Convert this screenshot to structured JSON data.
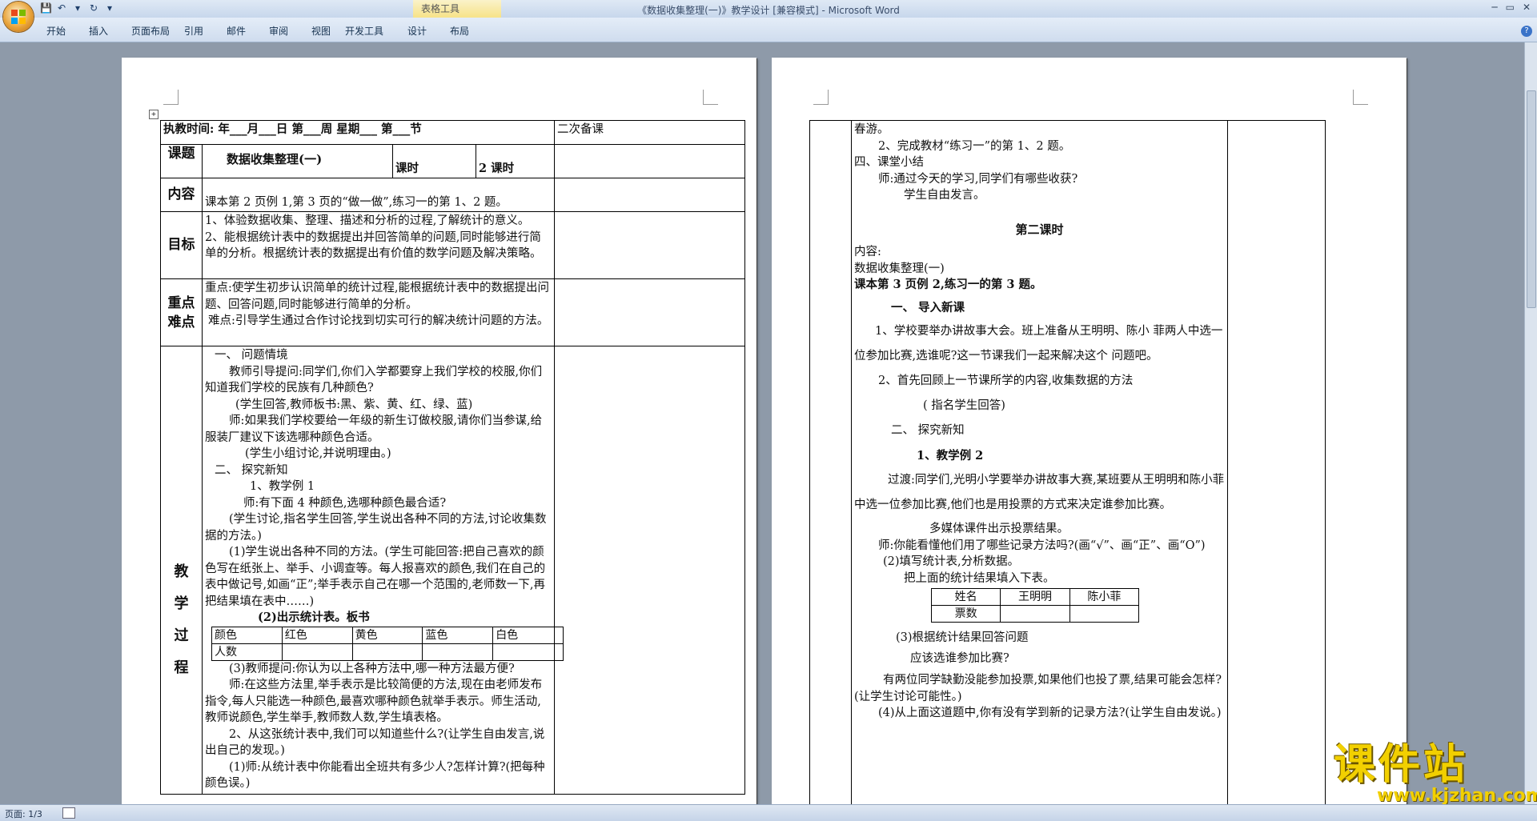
{
  "window": {
    "title": "《数据收集整理(一)》教学设计 [兼容模式] - Microsoft Word",
    "context_tools": "表格工具"
  },
  "ribbon": {
    "tabs": [
      "开始",
      "插入",
      "页面布局",
      "引用",
      "邮件",
      "审阅",
      "视图",
      "开发工具",
      "设计",
      "布局"
    ]
  },
  "status": {
    "page": "页面: 1/3"
  },
  "page1": {
    "exec_time": "执教时间:      年___月___日      第___周 星期___ 第___节",
    "second_prep": "二次备课",
    "topic_label": "课题",
    "topic": "数据收集整理(一)",
    "period_label": "课时",
    "period_value": "2 课时",
    "content_label": "内容",
    "content": "课本第 2 页例 1,第 3 页的“做一做”,练习一的第 1、2 题。",
    "goal_label": "目标",
    "goals": [
      "1、体验数据收集、整理、描述和分析的过程,了解统计的意义。",
      "2、能根据统计表中的数据提出并回答简单的问题,同时能够进行简单的分析。根据统计表的数据提出有价值的数学问题及解决策略。"
    ],
    "key_label_1": "重点",
    "key_label_2": "难点",
    "key_point": "重点:使学生初步认识简单的统计过程,能根据统计表中的数据提出问题、回答问题,同时能够进行简单的分析。",
    "difficult_point": "难点:引导学生通过合作讨论找到切实可行的解决统计问题的方法。",
    "process_label": [
      "教",
      "学",
      "过",
      "程"
    ],
    "process": [
      "一、  问题情境",
      "教师引导提问:同学们,你们入学都要穿上我们学校的校服,你们知道我们学校的民族有几种颜色?",
      "(学生回答,教师板书:黑、紫、黄、红、绿、蓝)",
      "师:如果我们学校要给一年级的新生订做校服,请你们当参谋,给服装厂建议下该选哪种颜色合适。",
      "(学生小组讨论,并说明理由。)",
      "二、  探究新知",
      "1、教学例 1",
      "师:有下面 4 种颜色,选哪种颜色最合适?",
      "(学生讨论,指名学生回答,学生说出各种不同的方法,讨论收集数据的方法。)",
      "(1)学生说出各种不同的方法。(学生可能回答:把自己喜欢的颜色写在纸张上、举手、小调查等。每人报喜欢的颜色,我们在自己的表中做记号,如画“正”;举手表示自己在哪一个范围的,老师数一下,再把结果填在表中……)",
      "(2)出示统计表。板书",
      "(3)教师提问:你认为以上各种方法中,哪一种方法最方便?",
      "师:在这些方法里,举手表示是比较简便的方法,现在由老师发布指令,每人只能选一种颜色,最喜欢哪种颜色就举手表示。师生活动,教师说颜色,学生举手,教师数人数,学生填表格。",
      "2、从这张统计表中,我们可以知道些什么?(让学生自由发言,说出自己的发现。)",
      "(1)师:从统计表中你能看出全班共有多少人?怎样计算?(把每种颜色误。)"
    ],
    "color_table": {
      "headers": [
        "颜色",
        "红色",
        "黄色",
        "蓝色",
        "白色"
      ],
      "row_label": "人数"
    }
  },
  "page2": {
    "lines_top": [
      "春游。",
      "2、完成教材“练习一”的第 1、2 题。",
      "四、课堂小结",
      "师:通过今天的学习,同学们有哪些收获?",
      "学生自由发言。"
    ],
    "second_period": "第二课时",
    "content_label": "内容:",
    "content_title": "数据收集整理(一)",
    "content_scope": "课本第 3 页例 2,练习一的第 3 题。",
    "intro_heading": "一、 导入新课",
    "intro_1": "1、学校要举办讲故事大会。班上准备从王明明、陈小 菲两人中选一位参加比赛,选谁呢?这一节课我们一起来解决这个 问题吧。",
    "intro_2": "2、首先回顾上一节课所学的内容,收集数据的方法",
    "intro_3": "( 指名学生回答)",
    "explore_heading": "二、 探究新知",
    "example_2": "1、教学例 2",
    "transition": "过渡:同学们,光明小学要举办讲故事大赛,某班要从王明明和陈小菲中选一位参加比赛,他们也是用投票的方式来决定谁参加比赛。",
    "multimedia": "多媒体课件出示投票结果。",
    "ask_methods": "师:你能看懂他们用了哪些记录方法吗?(画“√”、画“正”、画“O”)",
    "fill_table": "(2)填写统计表,分析数据。",
    "fill_table_sub": "把上面的统计结果填入下表。",
    "vote_table": {
      "headers": [
        "姓名",
        "王明明",
        "陈小菲"
      ],
      "row_label": "票数"
    },
    "answer_q": "(3)根据统计结果回答问题",
    "who_should": "应该选谁参加比赛?",
    "absent": "有两位同学缺勤没能参加投票,如果他们也投了票,结果可能会怎样?(让学生讨论可能性。)",
    "new_method": "(4)从上面这道题中,你有没有学到新的记录方法?(让学生自由发说。)"
  },
  "watermark": {
    "text": "课件站",
    "url": "www.kjzhan.com"
  }
}
